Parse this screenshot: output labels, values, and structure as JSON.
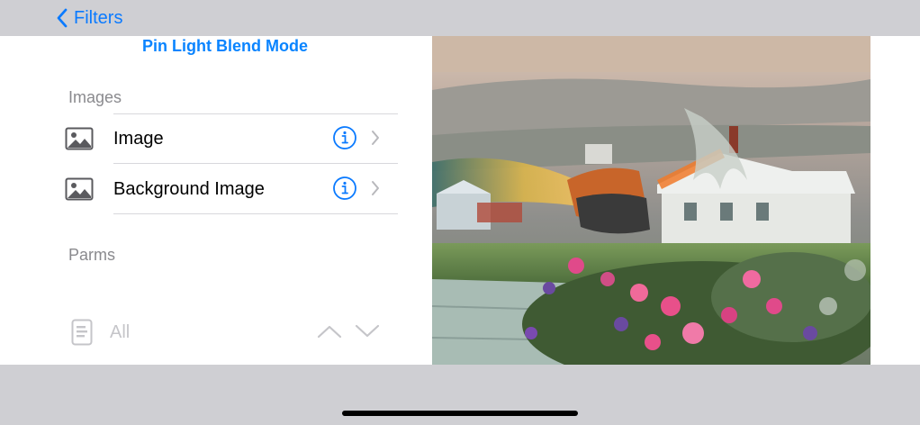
{
  "nav": {
    "back_label": "Filters"
  },
  "panel": {
    "title": "Pin Light Blend Mode",
    "images_header": "Images",
    "images": [
      {
        "label": "Image",
        "icon": "photo-icon"
      },
      {
        "label": "Background Image",
        "icon": "photo-icon"
      }
    ],
    "parms_header": "Parms",
    "selector": {
      "label": "All",
      "icon": "list-icon"
    }
  },
  "colors": {
    "accent": "#0a84ff",
    "secondary_text": "#8a8a8e",
    "disabled_text": "#c5c5c9",
    "chrome": "#cfcfd3"
  }
}
